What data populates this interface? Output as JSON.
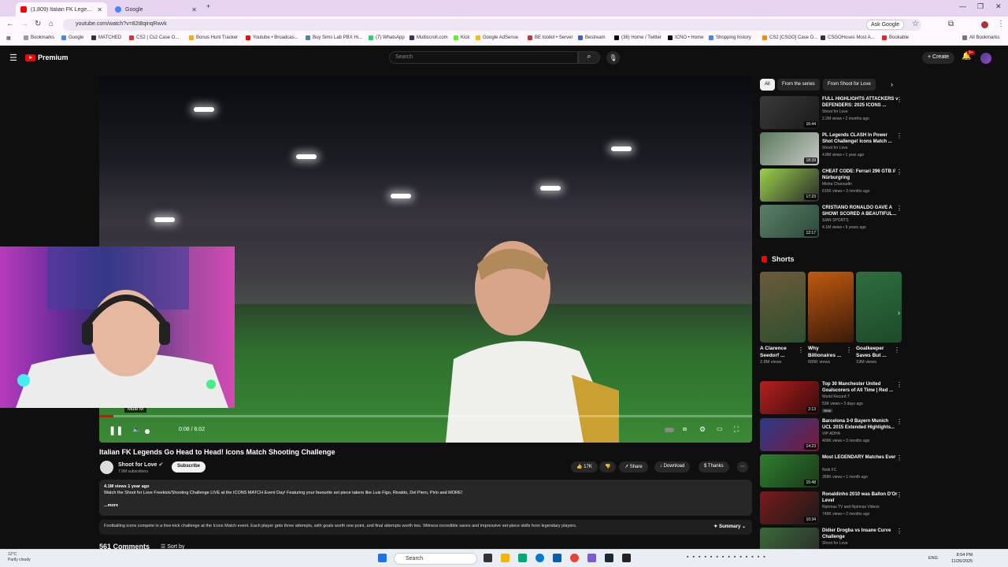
{
  "browser": {
    "tabs": [
      {
        "title": "(1,809) Italian FK Legends Go",
        "active": true
      },
      {
        "title": "Google",
        "active": false
      }
    ],
    "url": "youtube.com/watch?v=82t8qinqRwvk",
    "ask_google": "Ask Google",
    "all_bookmarks": "All Bookmarks",
    "bookmarks": [
      "Bookmarks",
      "Google",
      "MATCHED",
      "CS2 | Cs2 Case O...",
      "Bonus Hunt Tracker",
      "Youtube • Broadcas...",
      "Buy Sims Lab PBX Hi...",
      "(7) WhatsApp",
      "Multiscroll.com",
      "Kick",
      "Google AdSense",
      "BE toolkit • Server",
      "Bestream",
      "(36) Home / Twitter",
      "ICNO • Home",
      "Shopping history",
      "CS2 [CSGO] Case O...",
      "CSGOHoses Most A...",
      "Bookable"
    ]
  },
  "youtube": {
    "brand": "Premium",
    "search_placeholder": "Search",
    "create_label": "Create",
    "notif_count": "9+"
  },
  "player": {
    "time": "0:08 / 6:02",
    "progress": 0.022,
    "tooltip": "Mute  M"
  },
  "video": {
    "title": "Italian FK Legends Go Head to Head! Icons Match Shooting Challenge",
    "channel": "Shoot for Love",
    "subs": "7.9M subscribers",
    "subscribe": "Subscribe",
    "likes": "17K",
    "share": "Share",
    "download": "Download",
    "thanks": "Thanks",
    "views_age": "4.1M views  1 year ago",
    "description": "Watch the Shoot for Love Freekick/Shooting Challenge LIVE at the ICONS MATCH Event Day! Featuring your favourite set piece takers like Luis Figo, Rivaldo, Del Piero, Pirlo and MORE!",
    "more": "...more",
    "summary_text": "Footballing icons compete in a free-kick challenge at the Icons Match event. Each player gets three attempts, with goals worth one point, and final attempts worth two. Witness incredible saves and impressive set-piece skills from legendary players.",
    "summary_btn": "Summary",
    "comments": "561 Comments",
    "sort": "Sort by"
  },
  "sidebar": {
    "chips": [
      "All",
      "From the series",
      "From Shoot for Love"
    ],
    "recs": [
      {
        "title": "FULL HIGHLIGHTS ATTACKERS v DEFENDERS: 2025 ICONS ...",
        "channel": "Shoot for Love",
        "meta": "2.2M views • 2 months ago",
        "duration": "16:44",
        "colors": [
          "#3a3a3a",
          "#1a1a1a"
        ]
      },
      {
        "title": "PL Legends CLASH In Power Shot Challenge! Icons Match ...",
        "channel": "Shoot for Love",
        "meta": "4.8M views • 1 year ago",
        "duration": "18:39",
        "colors": [
          "#5a7a5a",
          "#c9c9c9"
        ]
      },
      {
        "title": "CHEAT CODE: Ferrari 296 GTB // Nürburgring",
        "channel": "Misha Charoudin",
        "meta": "615K views • 3 months ago",
        "duration": "17:23",
        "colors": [
          "#9ad24a",
          "#2a2a2a"
        ]
      },
      {
        "title": "CRISTIANO RONALDO GAVE A SHOW! SCORED A BEAUTIFUL...",
        "channel": "SIAN SPORTS",
        "meta": "4.1M views • 9 years ago",
        "duration": "12:17",
        "colors": [
          "#5b7f66",
          "#2a4a3a"
        ]
      }
    ],
    "shorts_title": "Shorts",
    "shorts": [
      {
        "title": "A Clarence Seedorf ...",
        "views": "2.8M views",
        "colors": [
          "#6b5b3a",
          "#2f4f2f"
        ]
      },
      {
        "title": "Why Billionaires ...",
        "views": "606K views",
        "colors": [
          "#c05a10",
          "#3a1a0a"
        ]
      },
      {
        "title": "Goalkeeper Saves But ...",
        "views": "19M views",
        "colors": [
          "#2e6e3e",
          "#1e4a2a"
        ]
      }
    ],
    "recs2": [
      {
        "title": "Top 30 Manchester United Goalscorers of All Time | Red ...",
        "channel": "World Record 7",
        "meta": "53K views • 3 days ago",
        "badge": "New",
        "duration": "2:13",
        "colors": [
          "#b52020",
          "#3a0a0a"
        ]
      },
      {
        "title": "Barcelona 3-0 Bayern Munich UCL 2015 Extended Highlights...",
        "channel": "VIP ADHA",
        "meta": "409K views • 3 months ago",
        "duration": "14:23",
        "colors": [
          "#2a3a8a",
          "#7a1a3a"
        ]
      },
      {
        "title": "Most LEGENDARY Matches Ever",
        "channel": "Notti FC",
        "meta": "358K views • 1 month ago",
        "duration": "15:48",
        "colors": [
          "#2e7e2e",
          "#1a3a1a"
        ]
      },
      {
        "title": "Ronaldinho 2010 was Ballon D'Or Level",
        "channel": "Rpirmas TV and Rpirmas Videos",
        "meta": "749K views • 2 months ago",
        "duration": "10:34",
        "colors": [
          "#7a1a1a",
          "#1a1a1a"
        ]
      },
      {
        "title": "Didier Drogba vs Insane Curve Challenge",
        "channel": "Shoot for Love",
        "meta": "",
        "duration": "",
        "colors": [
          "#3a6a3a",
          "#2a2a2a"
        ]
      }
    ]
  },
  "taskbar": {
    "weather_temp": "12°C",
    "weather_desc": "Partly cloudy",
    "search": "Search",
    "lang": "ENG",
    "time": "8:54 PM",
    "date": "11/26/2025"
  }
}
